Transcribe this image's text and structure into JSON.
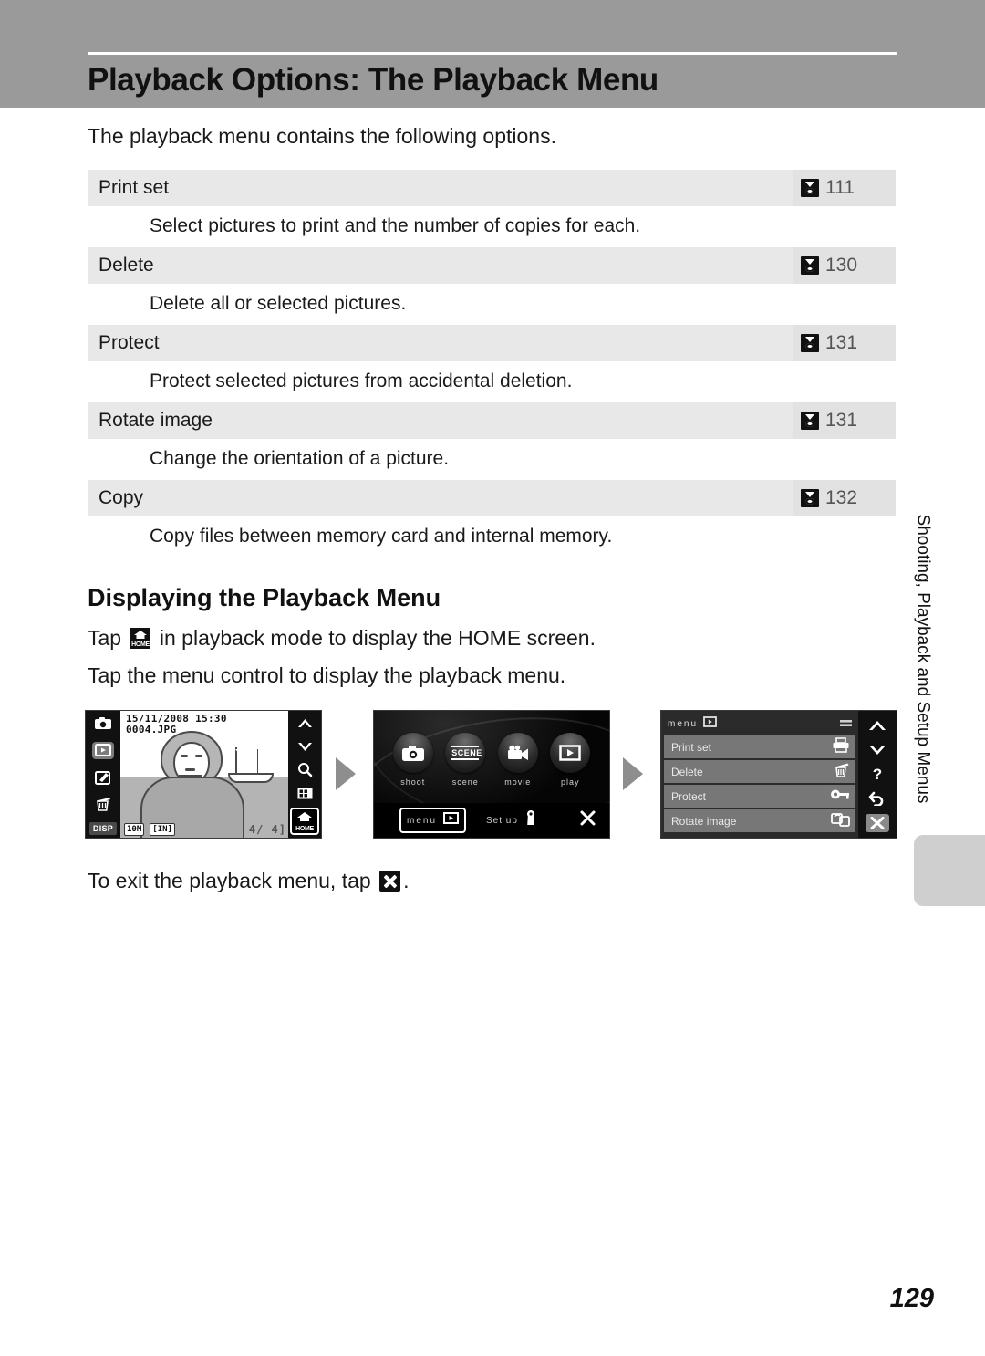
{
  "header": {
    "title": "Playback Options: The Playback Menu"
  },
  "intro": "The playback menu contains the following options.",
  "options": [
    {
      "name": "Print set",
      "icon": "page-ref-icon",
      "page": "111",
      "desc": "Select pictures to print and the number of copies for each."
    },
    {
      "name": "Delete",
      "icon": "page-ref-icon",
      "page": "130",
      "desc": "Delete all or selected pictures."
    },
    {
      "name": "Protect",
      "icon": "page-ref-icon",
      "page": "131",
      "desc": "Protect selected pictures from accidental deletion."
    },
    {
      "name": "Rotate image",
      "icon": "page-ref-icon",
      "page": "131",
      "desc": "Change the orientation of a picture."
    },
    {
      "name": "Copy",
      "icon": "page-ref-icon",
      "page": "132",
      "desc": "Copy files between memory card and internal memory."
    }
  ],
  "section": {
    "title": "Displaying the Playback Menu",
    "line1_before": "Tap",
    "line1_icon": "home-icon",
    "line1_after": "in playback mode to display the HOME screen.",
    "line2": "Tap the menu control to display the playback menu.",
    "exit_before": "To exit the playback menu, tap",
    "exit_icon": "close-x-icon",
    "exit_after": "."
  },
  "figures": {
    "screen1": {
      "date": "15/11/2008 15:30",
      "filename": "0004.JPG",
      "image_size_badge": "10M",
      "memory_badge": "IN",
      "frame_counter": "4/ 4",
      "left_controls": [
        {
          "name": "shooting-mode-icon",
          "selected": false
        },
        {
          "name": "playback-mode-icon",
          "selected": true
        },
        {
          "name": "edit-icon",
          "selected": false
        },
        {
          "name": "delete-icon",
          "selected": false
        },
        {
          "name": "disp-button",
          "label": "DISP",
          "selected": false
        }
      ],
      "right_controls": [
        {
          "name": "up-arrow-icon",
          "selected": false
        },
        {
          "name": "down-arrow-icon",
          "selected": false
        },
        {
          "name": "zoom-magnifier-icon",
          "selected": false
        },
        {
          "name": "thumbnail-grid-icon",
          "selected": false
        },
        {
          "name": "home-button",
          "label": "HOME",
          "selected": true
        }
      ]
    },
    "screen2": {
      "modes": [
        {
          "label": "shoot",
          "icon": "camera-icon"
        },
        {
          "label": "scene",
          "icon": "scene-icon",
          "glyph": "SCENE"
        },
        {
          "label": "movie",
          "icon": "movie-camera-icon"
        },
        {
          "label": "play",
          "icon": "play-icon"
        }
      ],
      "menu_control_label": "menu",
      "menu_control_icon": "play-icon",
      "setup_label": "Set up",
      "setup_icon": "wrench-icon",
      "close_icon": "close-x-icon"
    },
    "screen3": {
      "title": "menu",
      "title_icon": "play-icon",
      "header_icon": "equals-icon",
      "items": [
        {
          "label": "Print set",
          "icon": "printer-icon"
        },
        {
          "label": "Delete",
          "icon": "trash-icon"
        },
        {
          "label": "Protect",
          "icon": "key-icon"
        },
        {
          "label": "Rotate image",
          "icon": "rotate-icon"
        }
      ],
      "right_controls": [
        {
          "name": "up-arrow-icon",
          "selected": false
        },
        {
          "name": "down-arrow-icon",
          "selected": false
        },
        {
          "name": "help-icon",
          "label": "?",
          "selected": false
        },
        {
          "name": "back-arrow-icon",
          "selected": false
        },
        {
          "name": "close-x-icon",
          "selected": true
        }
      ]
    }
  },
  "side_tab": {
    "label": "Shooting, Playback and Setup Menus"
  },
  "page_number": "129",
  "colors": {
    "header_band": "#9a9a9a",
    "row_bg": "#e8e8e8",
    "ref_bg": "#e2e2e2",
    "tab_mark": "#cfcfcf"
  }
}
